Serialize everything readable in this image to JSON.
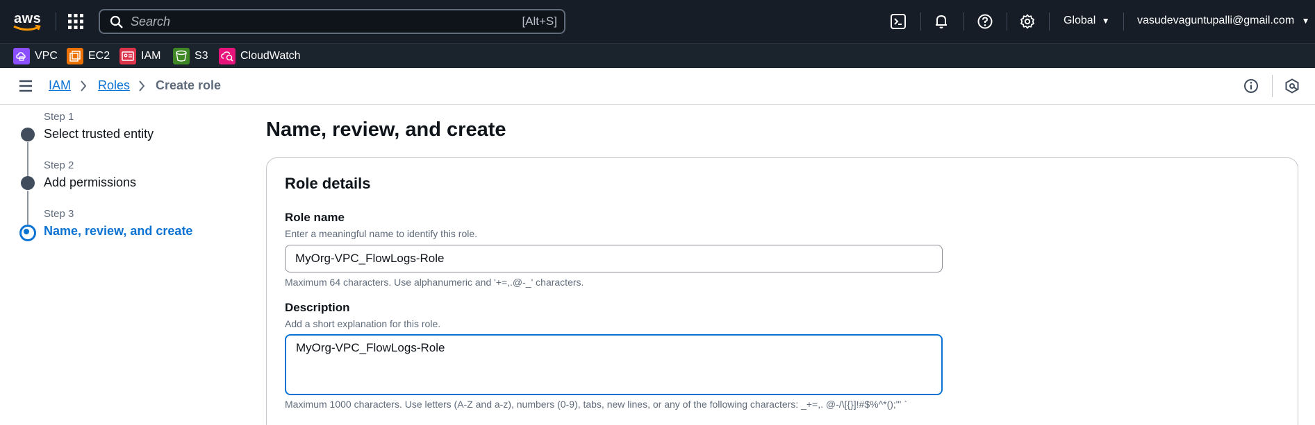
{
  "topnav": {
    "logo_text": "aws",
    "search_placeholder": "Search",
    "search_shortcut": "[Alt+S]",
    "region": "Global",
    "account": "vasudevaguntupalli@gmail.com",
    "icons": [
      "cloudshell-icon",
      "bell-icon",
      "help-icon",
      "settings-icon"
    ]
  },
  "services": [
    {
      "label": "VPC",
      "color": "#8c4fff"
    },
    {
      "label": "EC2",
      "color": "#ed7100"
    },
    {
      "label": "IAM",
      "color": "#dd344c"
    },
    {
      "label": "S3",
      "color": "#3f8624"
    },
    {
      "label": "CloudWatch",
      "color": "#e7157b"
    }
  ],
  "breadcrumb": {
    "items": [
      "IAM",
      "Roles"
    ],
    "current": "Create role"
  },
  "steps": [
    {
      "num": "Step 1",
      "title": "Select trusted entity"
    },
    {
      "num": "Step 2",
      "title": "Add permissions"
    },
    {
      "num": "Step 3",
      "title": "Name, review, and create"
    }
  ],
  "page": {
    "title": "Name, review, and create"
  },
  "role_details": {
    "heading": "Role details",
    "role_name": {
      "label": "Role name",
      "help": "Enter a meaningful name to identify this role.",
      "value": "MyOrg-VPC_FlowLogs-Role",
      "constraint": "Maximum 64 characters. Use alphanumeric and '+=,.@-_' characters."
    },
    "description": {
      "label": "Description",
      "help": "Add a short explanation for this role.",
      "value": "MyOrg-VPC_FlowLogs-Role",
      "constraint": "Maximum 1000 characters. Use letters (A-Z and a-z), numbers (0-9), tabs, new lines, or any of the following characters: _+=,. @-/\\[{}]!#$%^*();\"' `"
    }
  },
  "colors": {
    "nav_bg": "#161d26",
    "link": "#0972d3",
    "active_step": "#0972d3"
  }
}
